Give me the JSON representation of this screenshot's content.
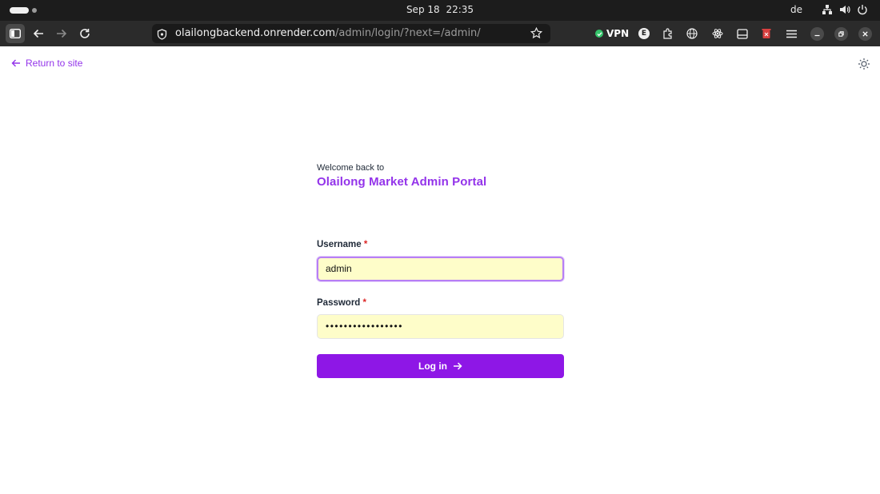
{
  "os": {
    "date": "Sep 18",
    "time": "22:35",
    "keyboard_layout": "de",
    "tray_icons": [
      "network-icon",
      "volume-icon",
      "power-icon"
    ]
  },
  "browser": {
    "url_host": "olailongbackend.onrender.com",
    "url_path": "/admin/login/?next=/admin/",
    "vpn_label": "VPN",
    "extension_badge": "E",
    "icons": [
      "sidebar-toggle-icon",
      "back-icon",
      "forward-icon",
      "reload-icon",
      "shield-icon",
      "bookmark-star-icon",
      "extensions-icon",
      "globe-icon",
      "react-icon",
      "wallet-icon",
      "trash-icon",
      "menu-icon",
      "minimize-icon",
      "restore-icon",
      "close-icon"
    ]
  },
  "page": {
    "return_link": "Return to site",
    "welcome_text": "Welcome back to",
    "portal_title": "Olailong Market Admin Portal",
    "username_label": "Username",
    "username_value": "admin",
    "password_label": "Password",
    "password_value": "•••••••••••••••••",
    "required_marker": "*",
    "login_button": "Log in"
  },
  "colors": {
    "accent": "#9333ea",
    "button": "#8e17e6",
    "autofill_bg": "#fefdc9",
    "required": "#dc2626"
  }
}
